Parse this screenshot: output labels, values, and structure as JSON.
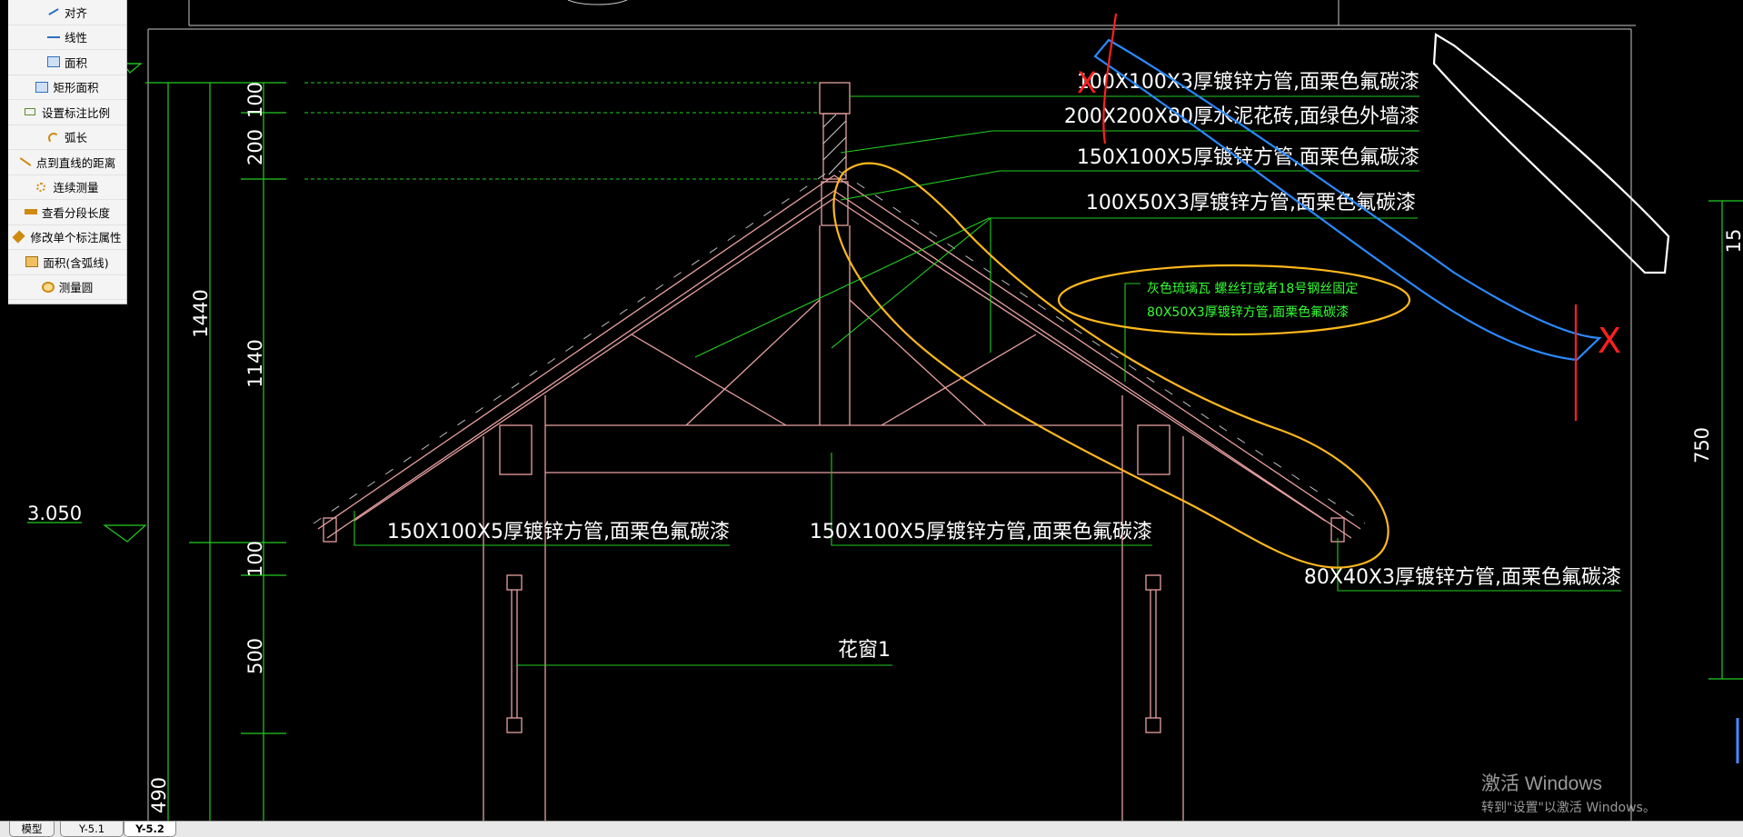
{
  "tool_panel": {
    "items": [
      {
        "label": "对齐",
        "icon": "align-icon"
      },
      {
        "label": "线性",
        "icon": "linear-icon"
      },
      {
        "label": "面积",
        "icon": "area-icon"
      },
      {
        "label": "矩形面积",
        "icon": "rect-area-icon"
      },
      {
        "label": "设置标注比例",
        "icon": "scale-icon"
      },
      {
        "label": "弧长",
        "icon": "arc-length-icon"
      },
      {
        "label": "点到直线的距离",
        "icon": "point-line-distance-icon"
      },
      {
        "label": "连续测量",
        "icon": "continuous-measure-icon"
      },
      {
        "label": "查看分段长度",
        "icon": "segment-length-icon"
      },
      {
        "label": "修改单个标注属性",
        "icon": "edit-dimension-icon"
      },
      {
        "label": "面积(含弧线)",
        "icon": "arc-area-icon"
      },
      {
        "label": "测量圆",
        "icon": "measure-circle-icon"
      }
    ]
  },
  "drawing": {
    "annotations": {
      "ridge_tube": "100X100X3厚镀锌方管,面栗色氟碳漆",
      "cement_brick": "200X200X80厚水泥花砖,面绿色外墙漆",
      "purlin_150": "150X100X5厚镀锌方管,面栗色氟碳漆",
      "brace_100x50": "100X50X3厚镀锌方管,面栗色氟碳漆",
      "tile_note": "灰色琉璃瓦 螺丝钉或者18号钢丝固定",
      "rafter_80x50": "80X50X3厚镀锌方管,面栗色氟碳漆",
      "beam_left": "150X100X5厚镀锌方管,面栗色氟碳漆",
      "beam_center": "150X100X5厚镀锌方管,面栗色氟碳漆",
      "eave_80x40": "80X40X3厚镀锌方管,面栗色氟碳漆",
      "window": "花窗1"
    },
    "dimensions": {
      "d100_top": "100",
      "d200": "200",
      "d1440": "1440",
      "d1140": "1140",
      "d100_mid": "100",
      "d500": "500",
      "d490": "490",
      "elev": "3.050",
      "d15": "15",
      "d750": "750"
    },
    "markup_marks": {
      "x_left": "X",
      "x_right": "X"
    }
  },
  "tabs": [
    {
      "label": "模型",
      "active": false
    },
    {
      "label": "Y-5.1",
      "active": false
    },
    {
      "label": "Y-5.2",
      "active": true
    }
  ],
  "watermark": {
    "title": "激活 Windows",
    "subtitle": "转到\"设置\"以激活 Windows。"
  },
  "colors": {
    "canvas_bg": "#000000",
    "dimension_green": "#22cc22",
    "structure_pink": "#e8a0a0",
    "markup_yellow": "#ffb81c",
    "markup_blue": "#2a8aff",
    "markup_red": "#ff2020"
  }
}
